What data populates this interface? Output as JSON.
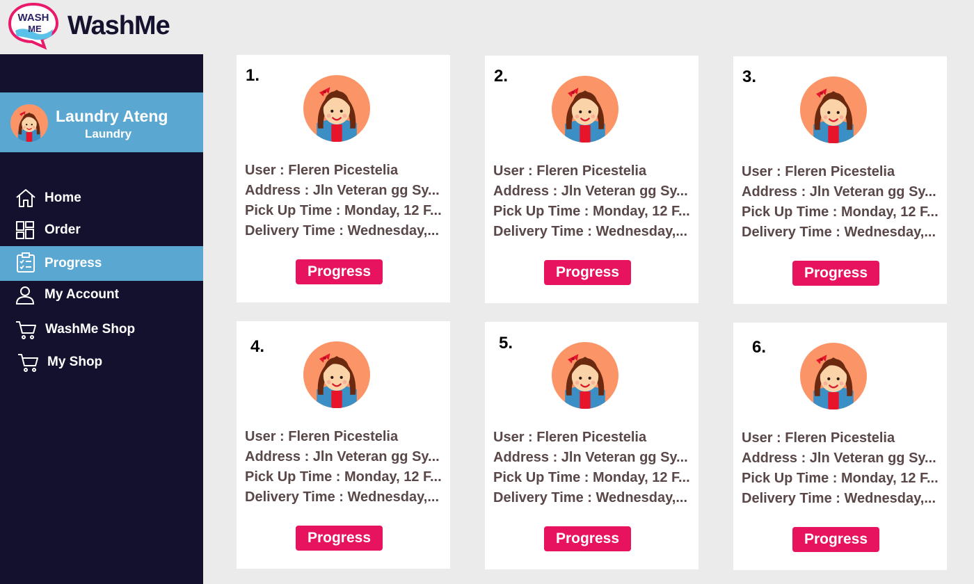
{
  "app": {
    "title": "WashMe",
    "logo_text_top": "WASH",
    "logo_text_bottom": "ME"
  },
  "profile": {
    "name": "Laundry Ateng",
    "role": "Laundry"
  },
  "nav": [
    {
      "label": "Home",
      "icon": "home-icon",
      "active": false
    },
    {
      "label": "Order",
      "icon": "order-icon",
      "active": false
    },
    {
      "label": "Progress",
      "icon": "clipboard-icon",
      "active": true
    },
    {
      "label": "My Account",
      "icon": "user-icon",
      "active": false
    },
    {
      "label": "WashMe Shop",
      "icon": "cart-icon",
      "active": false
    },
    {
      "label": "My Shop",
      "icon": "cart-icon",
      "active": false
    }
  ],
  "cards": [
    {
      "number": "1.",
      "user": "User : Fleren Picestelia",
      "address": "Address : Jln Veteran gg Sy...",
      "pickup": "Pick Up Time : Monday, 12 F...",
      "delivery": "Delivery Time : Wednesday,...",
      "button": "Progress"
    },
    {
      "number": "2.",
      "user": "User : Fleren Picestelia",
      "address": "Address : Jln Veteran gg Sy...",
      "pickup": "Pick Up Time : Monday, 12 F...",
      "delivery": "Delivery Time : Wednesday,...",
      "button": "Progress"
    },
    {
      "number": "3.",
      "user": "User : Fleren Picestelia",
      "address": "Address : Jln Veteran gg Sy...",
      "pickup": "Pick Up Time : Monday, 12 F...",
      "delivery": "Delivery Time : Wednesday,...",
      "button": "Progress"
    },
    {
      "number": "4.",
      "user": "User : Fleren Picestelia",
      "address": "Address : Jln Veteran gg Sy...",
      "pickup": "Pick Up Time : Monday, 12 F...",
      "delivery": "Delivery Time : Wednesday,...",
      "button": "Progress"
    },
    {
      "number": "5.",
      "user": "User : Fleren Picestelia",
      "address": "Address : Jln Veteran gg Sy...",
      "pickup": "Pick Up Time : Monday, 12 F...",
      "delivery": "Delivery Time : Wednesday,...",
      "button": "Progress"
    },
    {
      "number": "6.",
      "user": "User : Fleren Picestelia",
      "address": "Address : Jln Veteran gg Sy...",
      "pickup": "Pick Up Time : Monday, 12 F...",
      "delivery": "Delivery Time : Wednesday,...",
      "button": "Progress"
    }
  ],
  "colors": {
    "sidebar_bg": "#13112e",
    "accent_blue": "#5aa8d2",
    "button_pink": "#e8135f",
    "page_bg": "#ebebeb"
  }
}
